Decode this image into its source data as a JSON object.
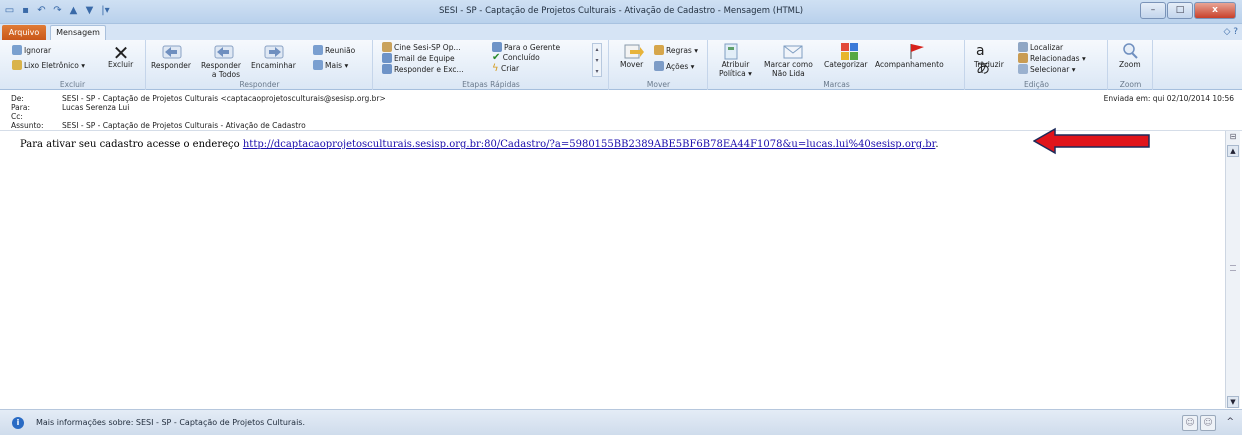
{
  "window": {
    "title": "SESI - SP - Captação de Projetos Culturais - Ativação de Cadastro  -  Mensagem (HTML)",
    "controls": {
      "minimize": "–",
      "maximize": "□",
      "close": "x"
    }
  },
  "tabs": {
    "file": "Arquivo",
    "message": "Mensagem"
  },
  "ribbon": {
    "groups": {
      "excluir": {
        "label": "Excluir",
        "ignorar": "Ignorar",
        "lixo": "Lixo Eletrônico",
        "excluir_btn": "Excluir"
      },
      "responder": {
        "label": "Responder",
        "responder": "Responder",
        "responder_todos_1": "Responder",
        "responder_todos_2": "a Todos",
        "encaminhar": "Encaminhar",
        "reuniao": "Reunião",
        "mais": "Mais"
      },
      "etapas": {
        "label": "Etapas Rápidas",
        "cine": "Cine Sesi-SP Op...",
        "email_equipe": "Email de Equipe",
        "responder_exc": "Responder e Exc...",
        "para_gerente": "Para o Gerente",
        "concluido": "Concluído",
        "criar": "Criar"
      },
      "mover": {
        "label": "Mover",
        "mover_btn": "Mover",
        "regras": "Regras",
        "acoes": "Ações"
      },
      "marcas": {
        "label": "Marcas",
        "atribuir_1": "Atribuir",
        "atribuir_2": "Política",
        "marcar_1": "Marcar como",
        "marcar_2": "Não Lida",
        "categorizar": "Categorizar",
        "acompanhamento": "Acompanhamento"
      },
      "edicao": {
        "label": "Edição",
        "traduzir": "Traduzir",
        "localizar": "Localizar",
        "relacionadas": "Relacionadas",
        "selecionar": "Selecionar"
      },
      "zoom": {
        "label": "Zoom",
        "zoom_btn": "Zoom"
      }
    }
  },
  "header": {
    "from_label": "De:",
    "from_value": "SESI - SP - Captação de Projetos Culturais <captacaoprojetosculturais@sesisp.org.br>",
    "to_label": "Para:",
    "to_value": "Lucas Serenza Lui",
    "cc_label": "Cc:",
    "subject_label": "Assunto:",
    "subject_value": "SESI - SP - Captação de Projetos Culturais - Ativação de Cadastro",
    "sent": "Enviada em:   qui 02/10/2014 10:56"
  },
  "body": {
    "text": "Para ativar seu cadastro acesse o endereço ",
    "link": "http://dcaptacaoprojetosculturais.sesisp.org.br:80/Cadastro/?a=5980155BB2389ABE5BF6B78EA44F1078&u=lucas.lui%40sesisp.org.br",
    "trailing": "."
  },
  "status": {
    "text": "Mais informações sobre: SESI - SP - Captação de Projetos Culturais."
  },
  "colors": {
    "annotation_arrow": "#e0141b",
    "file_tab": "#d46424",
    "link": "#1a0dab"
  }
}
